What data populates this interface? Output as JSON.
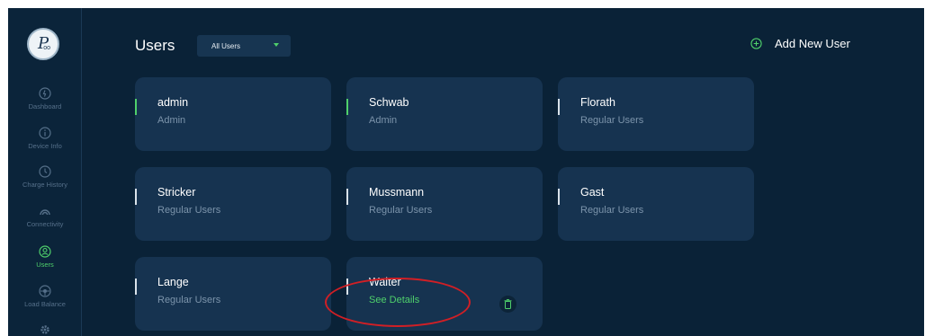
{
  "sidebar": {
    "logo_text": "P",
    "logo_sub": "oo",
    "items": [
      {
        "label": "Dashboard",
        "icon": "dashboard-icon",
        "active": false
      },
      {
        "label": "Device Info",
        "icon": "info-icon",
        "active": false
      },
      {
        "label": "Charge History",
        "icon": "clock-icon",
        "active": false
      },
      {
        "label": "Connectivity",
        "icon": "connectivity-icon",
        "active": false
      },
      {
        "label": "Users",
        "icon": "user-icon",
        "active": true
      },
      {
        "label": "Load Balance",
        "icon": "load-balance-icon",
        "active": false
      },
      {
        "label": "",
        "icon": "gear-icon",
        "active": false
      }
    ]
  },
  "header": {
    "title": "Users",
    "filter": {
      "value": "All Users"
    },
    "add_user_label": "Add New User"
  },
  "users": [
    {
      "name": "admin",
      "role": "Admin"
    },
    {
      "name": "Schwab",
      "role": "Admin"
    },
    {
      "name": "Florath",
      "role": "Regular Users"
    },
    {
      "name": "Stricker",
      "role": "Regular Users"
    },
    {
      "name": "Mussmann",
      "role": "Regular Users"
    },
    {
      "name": "Gast",
      "role": "Regular Users"
    },
    {
      "name": "Lange",
      "role": "Regular Users"
    },
    {
      "name": "Walter",
      "action": "See Details"
    }
  ],
  "colors": {
    "background": "#0a2237",
    "card": "#163350",
    "accent_green": "#4fd06b",
    "annotation_red": "#d11f25"
  }
}
